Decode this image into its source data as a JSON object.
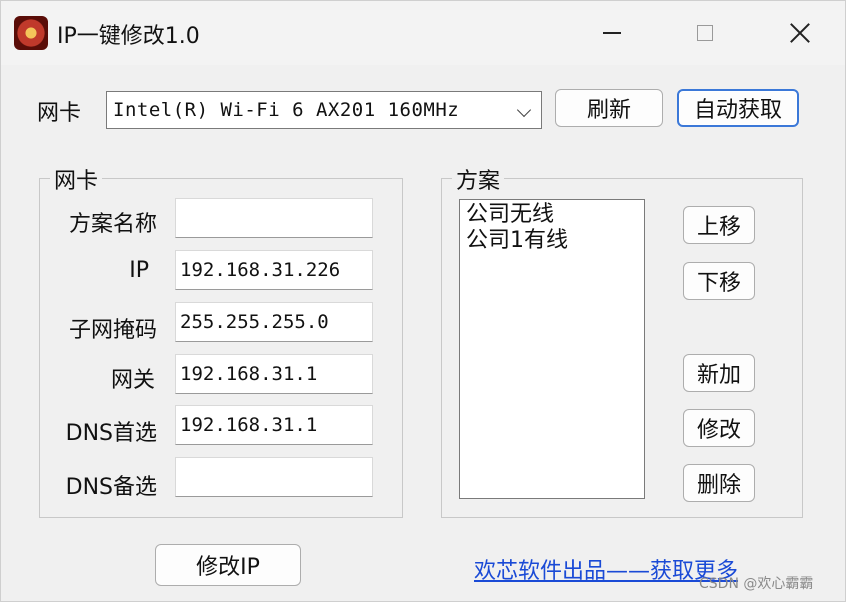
{
  "window": {
    "title": "IP一键修改1.0",
    "controls": [
      "minimize-icon",
      "maximize-icon",
      "close-icon"
    ]
  },
  "adapter_row": {
    "label": "网卡",
    "selected_adapter": "Intel(R) Wi-Fi 6 AX201 160MHz",
    "refresh_button": "刷新",
    "auto_button": "自动获取"
  },
  "config_group": {
    "legend": "网卡",
    "fields": [
      {
        "label": "方案名称",
        "value": ""
      },
      {
        "label": "IP",
        "value": "192.168.31.226"
      },
      {
        "label": "子网掩码",
        "value": "255.255.255.0"
      },
      {
        "label": "网关",
        "value": "192.168.31.1"
      },
      {
        "label": "DNS首选",
        "value": "192.168.31.1"
      },
      {
        "label": "DNS备选",
        "value": ""
      }
    ]
  },
  "scheme_group": {
    "legend": "方案",
    "items": [
      "公司无线",
      "公司1有线"
    ],
    "buttons": {
      "up": "上移",
      "down": "下移",
      "add": "新加",
      "edit": "修改",
      "delete": "删除"
    }
  },
  "footer": {
    "apply_button": "修改IP",
    "link": "欢芯软件出品——获取更多",
    "watermark": "CSDN @欢心霸霸"
  },
  "colors": {
    "accent": "#3b78d8",
    "link": "#1a4ad6",
    "background": "#f0f0f0"
  }
}
